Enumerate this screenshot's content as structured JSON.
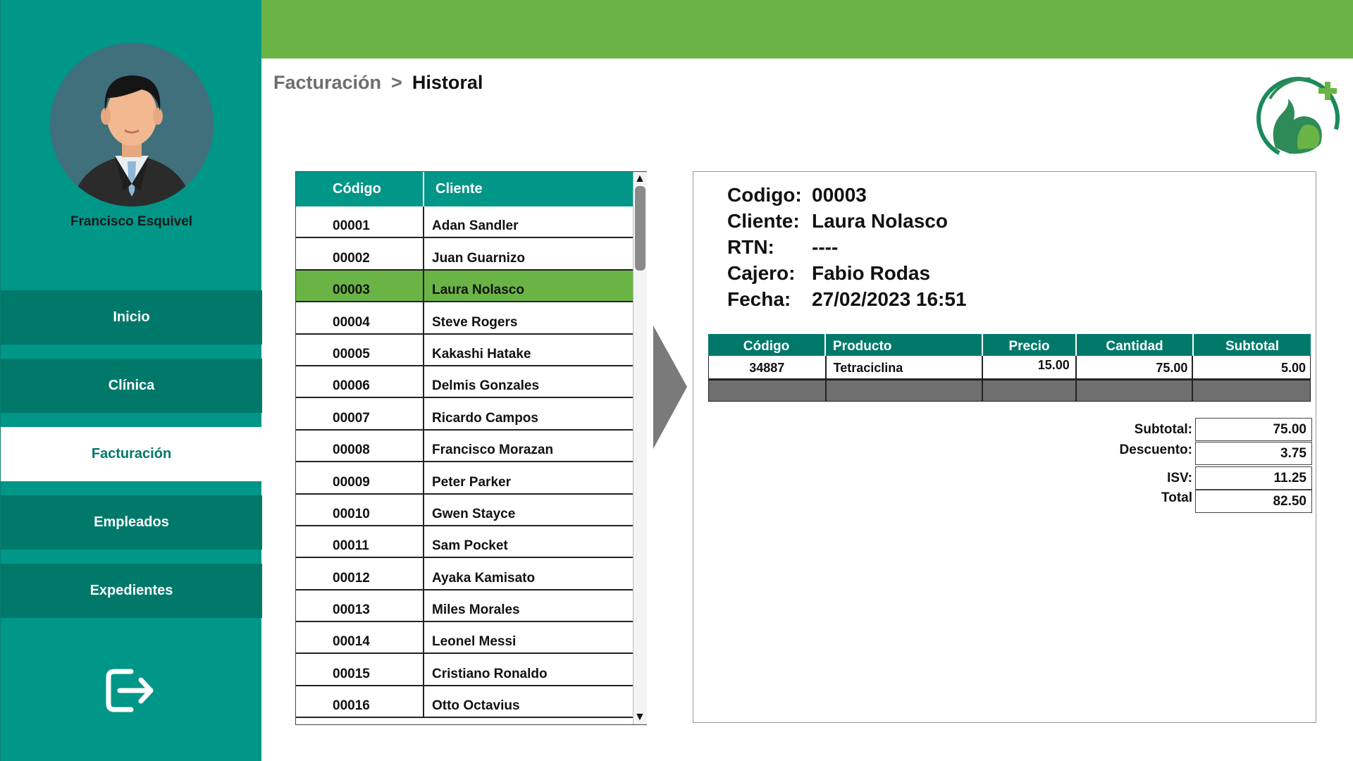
{
  "sidebar": {
    "user_name": "Francisco Esquivel",
    "nav": [
      {
        "label": "Inicio",
        "active": false
      },
      {
        "label": "Clínica",
        "active": false
      },
      {
        "label": "Facturación",
        "active": true
      },
      {
        "label": "Empleados",
        "active": false
      },
      {
        "label": "Expedientes",
        "active": false
      }
    ],
    "logout_icon": "logout-icon"
  },
  "breadcrumb": {
    "parent": "Facturación",
    "separator": ">",
    "current": "Historal"
  },
  "clients_table": {
    "headers": [
      "Código",
      "Cliente"
    ],
    "selected_code": "00003",
    "rows": [
      {
        "code": "00001",
        "name": "Adan Sandler"
      },
      {
        "code": "00002",
        "name": "Juan Guarnizo"
      },
      {
        "code": "00003",
        "name": "Laura Nolasco"
      },
      {
        "code": "00004",
        "name": "Steve Rogers"
      },
      {
        "code": "00005",
        "name": "Kakashi Hatake"
      },
      {
        "code": "00006",
        "name": "Delmis Gonzales"
      },
      {
        "code": "00007",
        "name": "Ricardo Campos"
      },
      {
        "code": "00008",
        "name": "Francisco Morazan"
      },
      {
        "code": "00009",
        "name": "Peter Parker"
      },
      {
        "code": "00010",
        "name": "Gwen Stayce"
      },
      {
        "code": "00011",
        "name": "Sam Pocket"
      },
      {
        "code": "00012",
        "name": "Ayaka Kamisato"
      },
      {
        "code": "00013",
        "name": "Miles Morales"
      },
      {
        "code": "00014",
        "name": "Leonel Messi"
      },
      {
        "code": "00015",
        "name": "Cristiano Ronaldo"
      },
      {
        "code": "00016",
        "name": "Otto Octavius"
      }
    ]
  },
  "invoice": {
    "labels": {
      "codigo": "Codigo:",
      "cliente": "Cliente:",
      "rtn": "RTN:",
      "cajero": "Cajero:",
      "fecha": "Fecha:"
    },
    "codigo": "00003",
    "cliente": "Laura Nolasco",
    "rtn": "----",
    "cajero": "Fabio Rodas",
    "fecha": "27/02/2023 16:51",
    "item_headers": [
      "Código",
      "Producto",
      "Precio",
      "Cantidad",
      "Subtotal"
    ],
    "items": [
      {
        "codigo": "34887",
        "producto": "Tetraciclina",
        "precio": "15.00",
        "cantidad": "75.00",
        "subtotal": "5.00"
      }
    ],
    "totals": {
      "subtotal_label": "Subtotal:",
      "subtotal": "75.00",
      "descuento_label": "Descuento:",
      "descuento": "3.75",
      "isv_label": "ISV:",
      "isv": "11.25",
      "total_label": "Total",
      "total": "82.50"
    }
  },
  "colors": {
    "teal": "#009688",
    "dark_teal": "#00796b",
    "green": "#6ab446",
    "gray": "#6f6f6f"
  }
}
